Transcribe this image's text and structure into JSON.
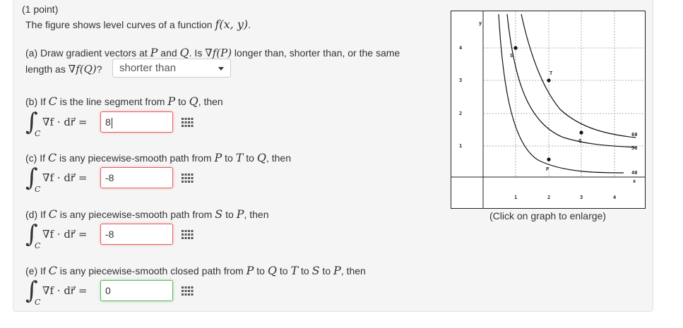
{
  "header": {
    "points": "(1 point)"
  },
  "intro": {
    "text": "The figure shows level curves of a function ",
    "func": "f(x, y)",
    "tail": "."
  },
  "part_a": {
    "line1_pre": "(a) Draw gradient vectors at ",
    "p": "P",
    "and": " and ",
    "q": "Q",
    "is": ". Is ",
    "gradP": "∇f(P)",
    "line1_post": " longer than, shorter than, or the same",
    "line2_pre": "length as ",
    "gradQ": "∇f(Q)",
    "line2_post": "?",
    "selected": "shorter than"
  },
  "part_b": {
    "pre": "(b) If ",
    "c": "C",
    "mid": " is the line segment from ",
    "p": "P",
    "to": " to ",
    "q": "Q",
    "post": ", then",
    "value": "8"
  },
  "part_c": {
    "pre": "(c) If ",
    "c": "C",
    "mid": " is any piecewise-smooth path from ",
    "p": "P",
    "to1": " to ",
    "t": "T",
    "to2": " to ",
    "q": "Q",
    "post": ", then",
    "value": "-8"
  },
  "part_d": {
    "pre": "(d) If ",
    "c": "C",
    "mid": " is any piecewise-smooth path from ",
    "s": "S",
    "to": " to ",
    "p": "P",
    "post": ", then",
    "value": "-8"
  },
  "part_e": {
    "pre": "(e) If ",
    "c": "C",
    "mid": " is any piecewise-smooth closed path from ",
    "p": "P",
    "t1": " to ",
    "q": "Q",
    "t2": " to ",
    "t": "T",
    "t3": " to ",
    "s": "S",
    "t4": " to ",
    "p2": "P",
    "post": ", then",
    "value": "0"
  },
  "integral": {
    "sign": "∫",
    "sub": "C",
    "expr": "∇f · dr⃗ ="
  },
  "graph": {
    "caption": "(Click on graph to enlarge)",
    "y_axis_label": "y",
    "x_axis_label": "x",
    "x_ticks": [
      "1",
      "2",
      "3",
      "4"
    ],
    "y_ticks": [
      "1",
      "2",
      "3",
      "4"
    ],
    "curve_labels": [
      "60",
      "50",
      "40"
    ],
    "point_labels": [
      "S",
      "T",
      "Q",
      "P"
    ]
  },
  "colors": {
    "error_border": "#e85d5d",
    "ok_border": "#5cb85c",
    "panel_bg": "#f5f5f5"
  }
}
